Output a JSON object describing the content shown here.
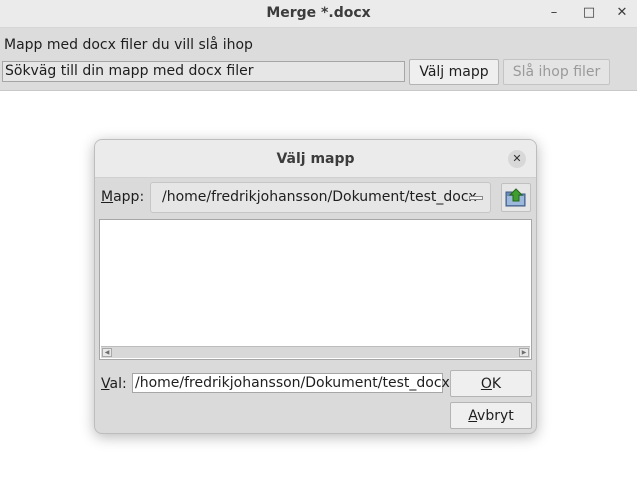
{
  "window": {
    "title": "Merge *.docx",
    "minimize_glyph": "–",
    "maximize_glyph": "□",
    "close_glyph": "✕"
  },
  "top_panel": {
    "label": "Mapp med docx filer du vill slå ihop",
    "path_field_value": "Sökväg till din mapp med docx filer",
    "choose_button_label": "Välj mapp",
    "merge_button_label": "Slå ihop filer",
    "merge_button_enabled": false
  },
  "dialog": {
    "title": "Välj mapp",
    "close_glyph": "✕",
    "folder_label_mnemonic": "M",
    "folder_label_rest": "app:",
    "folder_combo_value": "/home/fredrikjohansson/Dokument/test_docx",
    "up_icon": "folder-up-icon",
    "file_list_items": [],
    "selection_label_mnemonic": "V",
    "selection_label_rest": "al:",
    "selection_value": "/home/fredrikjohansson/Dokument/test_docx",
    "ok_mnemonic": "O",
    "ok_rest": "K",
    "cancel_mnemonic": "A",
    "cancel_rest": "vbryt"
  },
  "colors": {
    "panel_bg": "#dcdcdc",
    "titlebar_bg": "#ebebeb",
    "up_icon_green": "#3f9e2f",
    "up_icon_folder": "#6b8ab5"
  }
}
